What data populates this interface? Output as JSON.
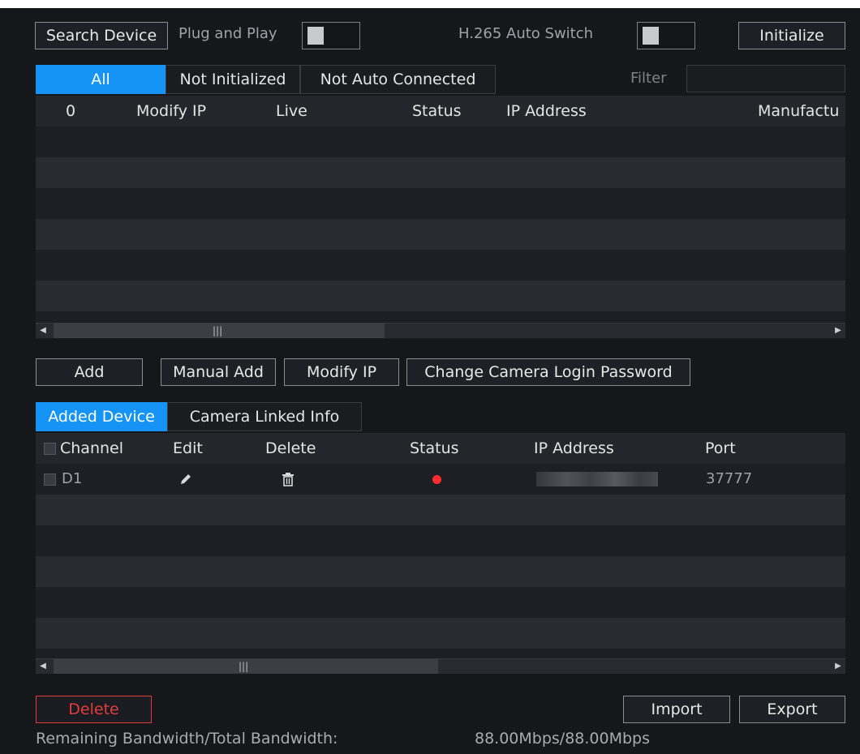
{
  "toolbar": {
    "search_device": "Search Device",
    "plug_and_play": "Plug and Play",
    "h265_auto_switch": "H.265 Auto Switch",
    "initialize": "Initialize"
  },
  "filter_tabs": {
    "all": "All",
    "not_initialized": "Not Initialized",
    "not_auto_connected": "Not Auto Connected",
    "filter_label": "Filter",
    "filter_value": ""
  },
  "search_table": {
    "columns": [
      "0",
      "Modify IP",
      "Live",
      "Status",
      "IP Address",
      "Manufactu"
    ]
  },
  "actions": {
    "add": "Add",
    "manual_add": "Manual Add",
    "modify_ip": "Modify IP",
    "change_password": "Change Camera Login Password"
  },
  "added_tabs": {
    "added_device": "Added Device",
    "camera_linked_info": "Camera Linked Info"
  },
  "added_table": {
    "columns": [
      "Channel",
      "Edit",
      "Delete",
      "Status",
      "IP Address",
      "Port"
    ],
    "rows": [
      {
        "channel": "D1",
        "status_color": "#ff2d2d",
        "port": "37777"
      }
    ]
  },
  "bottom": {
    "delete": "Delete",
    "import": "Import",
    "export": "Export",
    "bandwidth_label": "Remaining Bandwidth/Total Bandwidth:",
    "bandwidth_value": "88.00Mbps/88.00Mbps"
  },
  "colors": {
    "accent": "#1594f5",
    "danger": "#e43c3c"
  },
  "icons": [
    "pencil-icon",
    "trash-icon",
    "left-arrow-icon",
    "right-arrow-icon"
  ]
}
